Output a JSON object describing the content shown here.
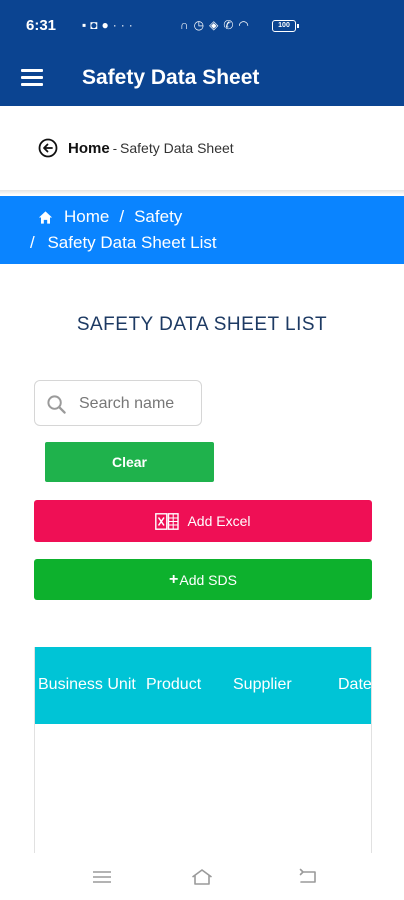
{
  "status_bar": {
    "time": "6:31",
    "battery": "100",
    "left_icons": [
      "signal-icon",
      "notification-icon",
      "sync-icon",
      "more-icon"
    ],
    "right_icons": [
      "headphones-icon",
      "alarm-icon",
      "vibrate-icon",
      "wifi-icon"
    ]
  },
  "app_bar": {
    "title": "Safety Data Sheet",
    "menu_icon": "hamburger-icon"
  },
  "top_breadcrumb": {
    "home": "Home",
    "separator": "-",
    "current": "Safety Data Sheet"
  },
  "blue_breadcrumb": {
    "home": "Home",
    "separator": "/",
    "section": "Safety",
    "current": "Safety Data Sheet List"
  },
  "list_title": "SAFETY DATA SHEET LIST",
  "search": {
    "placeholder": "Search name",
    "value": ""
  },
  "buttons": {
    "clear": "Clear",
    "add_excel": "Add Excel",
    "add_sds": "Add SDS"
  },
  "table": {
    "columns": [
      "Business Unit",
      "Product",
      "Supplier",
      "Date"
    ],
    "rows": []
  },
  "colors": {
    "header_bg": "#0b4491",
    "breadcrumb_bg": "#0a84ff",
    "clear_btn": "#1fb24c",
    "excel_btn": "#ef0f55",
    "sds_btn": "#0db12d",
    "table_header": "#00c4d6"
  },
  "nav_bar": [
    "menu-nav-icon",
    "home-nav-icon",
    "back-nav-icon"
  ]
}
